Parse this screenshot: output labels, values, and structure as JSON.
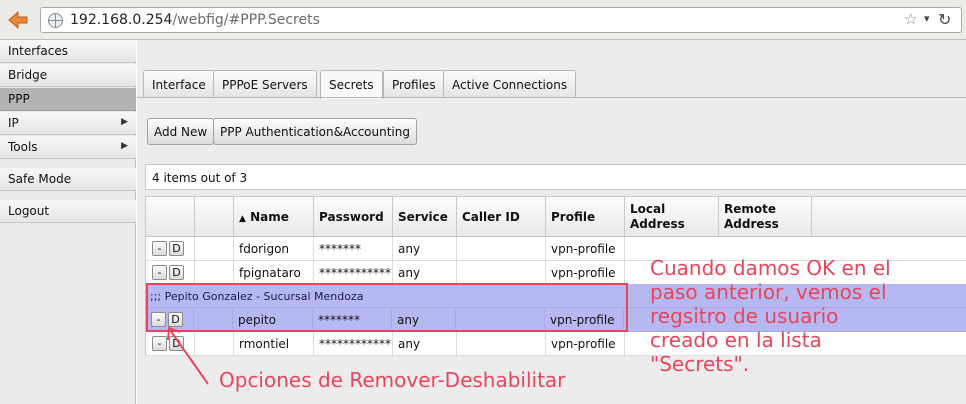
{
  "browser": {
    "back_icon": "back-arrow-icon",
    "url_host": "192.168.0.254",
    "url_path": "/webfig/#PPP.Secrets"
  },
  "sidebar": {
    "items": [
      {
        "label": "Interfaces"
      },
      {
        "label": "Bridge"
      },
      {
        "label": "PPP"
      },
      {
        "label": "IP"
      },
      {
        "label": "Tools"
      },
      {
        "label": "Safe Mode"
      },
      {
        "label": "Logout"
      }
    ]
  },
  "tabs": [
    {
      "label": "Interface"
    },
    {
      "label": "PPPoE Servers"
    },
    {
      "label": "Secrets"
    },
    {
      "label": "Profiles"
    },
    {
      "label": "Active Connections"
    }
  ],
  "toolbar": {
    "add_new": "Add New",
    "auth_accounting": "PPP Authentication&Accounting"
  },
  "items_count": "4 items out of 3",
  "table": {
    "headers": {
      "name": "Name",
      "sort_arrow": "▲",
      "password": "Password",
      "service": "Service",
      "caller_id": "Caller ID",
      "profile": "Profile",
      "local_address_1": "Local",
      "local_address_2": "Address",
      "remote_address_1": "Remote",
      "remote_address_2": "Address"
    },
    "remove_label": "-",
    "disable_label": "D",
    "rows": [
      {
        "name": "fdorigon",
        "password": "*******",
        "service": "any",
        "caller_id": "",
        "profile": "vpn-profile"
      },
      {
        "name": "fpignataro",
        "password": "************",
        "service": "any",
        "caller_id": "",
        "profile": "vpn-profile"
      },
      {
        "name": "pepito",
        "password": "*******",
        "service": "any",
        "caller_id": "",
        "profile": "vpn-profile"
      },
      {
        "name": "rmontiel",
        "password": "************",
        "service": "any",
        "caller_id": "",
        "profile": "vpn-profile"
      }
    ],
    "comment": ";;; Pepito Gonzalez - Sucursal Mendoza"
  },
  "annotations": {
    "right_line1": "Cuando damos OK en el",
    "right_line2": "paso anterior, vemos el",
    "right_line3": "regsitro de usuario",
    "right_line4": "creado en la lista",
    "right_line5": "\"Secrets\".",
    "left": "Opciones de Remover-Deshabilitar",
    "color": "#e8455a"
  }
}
